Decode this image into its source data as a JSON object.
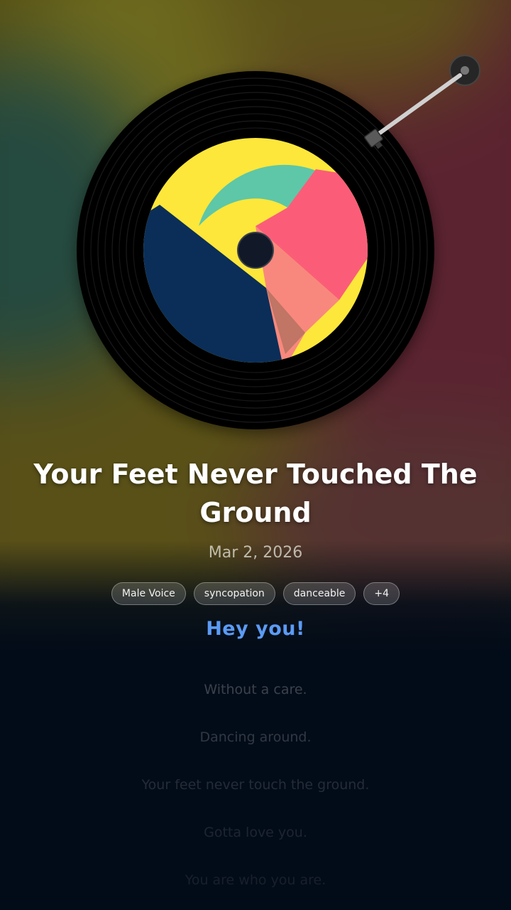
{
  "song": {
    "title": "Your Feet Never Touched The Ground",
    "date": "Mar 2, 2026"
  },
  "tags": [
    "Male Voice",
    "syncopation",
    "danceable",
    "+4"
  ],
  "lyrics": {
    "current": "Hey you!",
    "upcoming": [
      "Without a care.",
      "Dancing around.",
      "Your feet never touch the ground.",
      "Gotta love you.",
      "You are who you are."
    ]
  },
  "colors": {
    "background": "#020b18",
    "active_lyric": "#5b9bf5",
    "art_yellow": "#fde73a",
    "art_navy": "#0a2e58",
    "art_teal": "#5ec7a7",
    "art_pink": "#fb5d79",
    "art_salmon": "#f8887d"
  },
  "icons": {
    "tonearm": "tonearm-icon",
    "record": "vinyl-record-icon"
  }
}
